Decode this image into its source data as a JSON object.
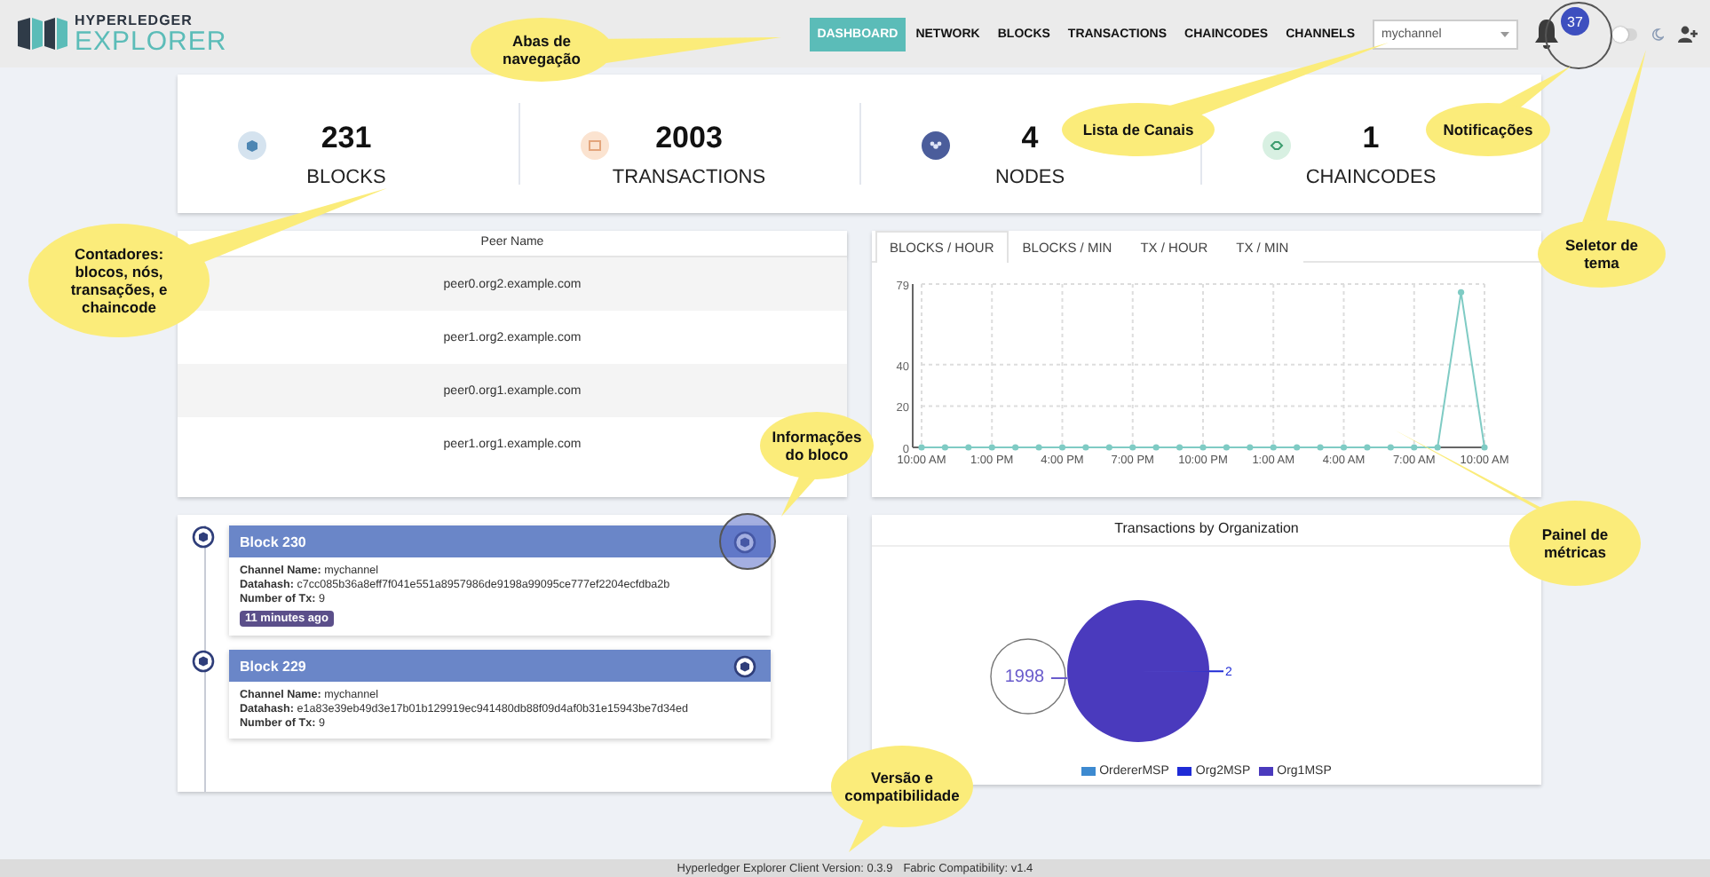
{
  "header": {
    "logo_top": "HYPERLEDGER",
    "logo_bottom": "EXPLORER"
  },
  "nav_tabs": [
    {
      "label": "DASHBOARD",
      "selected": true
    },
    {
      "label": "NETWORK",
      "selected": false
    },
    {
      "label": "BLOCKS",
      "selected": false
    },
    {
      "label": "TRANSACTIONS",
      "selected": false
    },
    {
      "label": "CHAINCODES",
      "selected": false
    },
    {
      "label": "CHANNELS",
      "selected": false
    }
  ],
  "channel_select": {
    "value": "mychannel"
  },
  "notifications": {
    "count": "37"
  },
  "theme_toggle": {
    "on": false
  },
  "stats": [
    {
      "kind": "blocks",
      "value": "231",
      "label": "BLOCKS"
    },
    {
      "kind": "transactions",
      "value": "2003",
      "label": "TRANSACTIONS"
    },
    {
      "kind": "nodes",
      "value": "4",
      "label": "NODES"
    },
    {
      "kind": "chaincodes",
      "value": "1",
      "label": "CHAINCODES"
    }
  ],
  "peers": {
    "column": "Peer Name",
    "rows": [
      "peer0.org2.example.com",
      "peer1.org2.example.com",
      "peer0.org1.example.com",
      "peer1.org1.example.com"
    ]
  },
  "metrics": {
    "tabs": [
      {
        "label": "BLOCKS / HOUR",
        "selected": true
      },
      {
        "label": "BLOCKS / MIN",
        "selected": false
      },
      {
        "label": "TX / HOUR",
        "selected": false
      },
      {
        "label": "TX / MIN",
        "selected": false
      }
    ],
    "chart_data": {
      "type": "line",
      "categories": [
        "10:00 AM",
        null,
        null,
        "1:00 PM",
        null,
        null,
        "4:00 PM",
        null,
        null,
        "7:00 PM",
        null,
        null,
        "10:00 PM",
        null,
        null,
        "1:00 AM",
        null,
        null,
        "4:00 AM",
        null,
        null,
        "7:00 AM",
        null,
        null,
        "10:00 AM"
      ],
      "values": [
        0,
        0,
        0,
        0,
        0,
        0,
        0,
        0,
        0,
        0,
        0,
        0,
        0,
        0,
        0,
        0,
        0,
        0,
        0,
        0,
        0,
        0,
        0,
        75,
        0
      ],
      "ylim": [
        0,
        79
      ],
      "yticks": [
        0,
        20,
        40,
        79
      ],
      "grid": true,
      "marker": true
    }
  },
  "blocks": [
    {
      "title": "Block 230",
      "fields": [
        {
          "label": "Channel Name:",
          "value": "mychannel"
        },
        {
          "label": "Datahash:",
          "value": "c7cc085b36a8eff7f041e551a8957986de9198a99095ce777ef2204ecfdba2b"
        },
        {
          "label": "Number of Tx:",
          "value": "9"
        }
      ],
      "time": "11 minutes ago"
    },
    {
      "title": "Block 229",
      "fields": [
        {
          "label": "Channel Name:",
          "value": "mychannel"
        },
        {
          "label": "Datahash:",
          "value": "e1a83e39eb49d3e17b01b129919ec941480db88f09d4af0b31e15943be7d34ed"
        },
        {
          "label": "Number of Tx:",
          "value": "9"
        }
      ]
    }
  ],
  "org_chart": {
    "chart_data": {
      "type": "pie",
      "title": "Transactions by Organization",
      "categories": [
        "OrdererMSP",
        "Org2MSP",
        "Org1MSP"
      ],
      "values": [
        0,
        2,
        1998
      ],
      "data_labels": true
    },
    "legend": [
      {
        "color": "#3d8ad0"
      },
      {
        "color": "#1f2bd6"
      },
      {
        "color": "#4a3abd"
      }
    ]
  },
  "footer": {
    "version": "Hyperledger Explorer Client Version: 0.3.9",
    "compat": "Fabric Compatibility: v1.4"
  },
  "annotations": [
    {
      "text": "Abas de\nnavegação"
    },
    {
      "text": "Lista de Canais"
    },
    {
      "text": "Notificações"
    },
    {
      "text": "Seletor de\ntema"
    },
    {
      "text": "Contadores:\nblocos, nós,\ntransações, e\nchaincode"
    },
    {
      "text": "Informações\ndo bloco"
    },
    {
      "text": "Painel de\nmétricas"
    },
    {
      "text": "Versão e\ncompatibilidade"
    }
  ]
}
